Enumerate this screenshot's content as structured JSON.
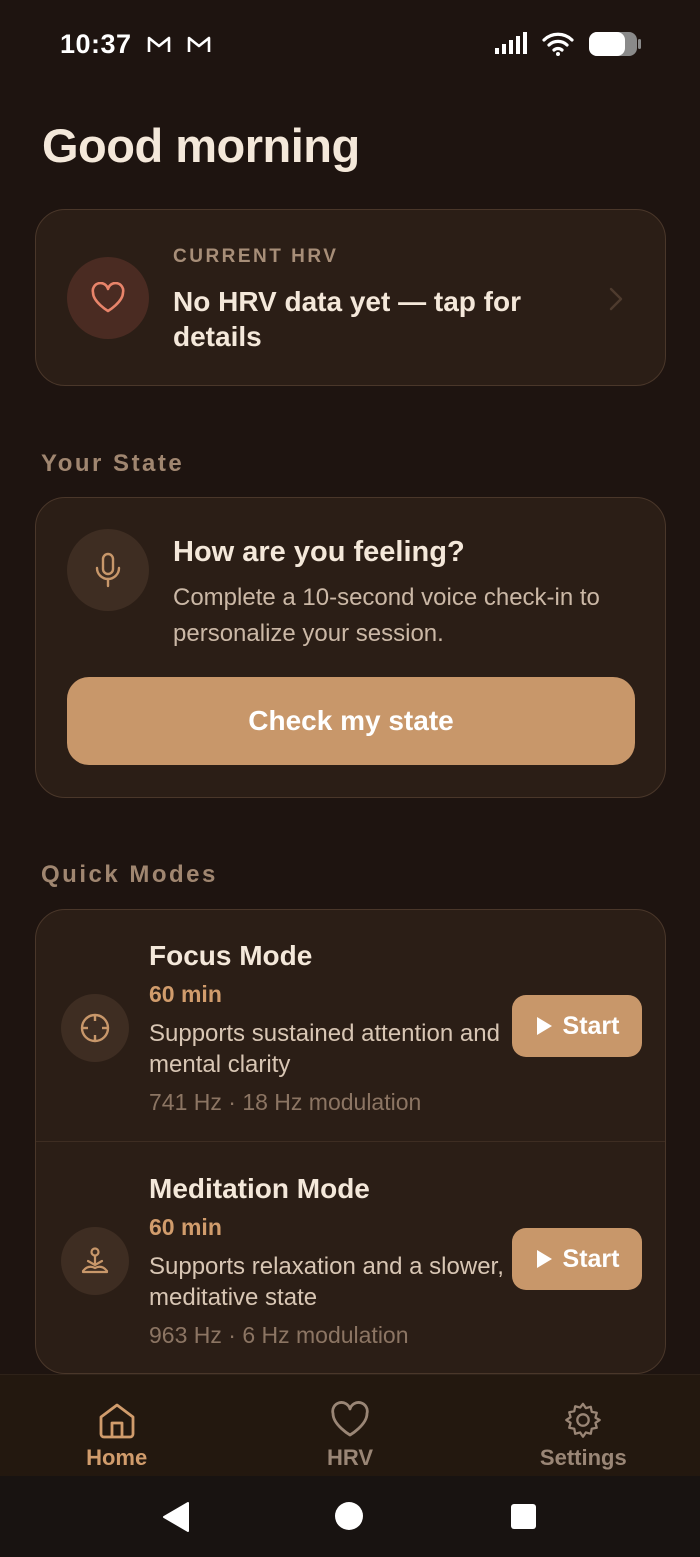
{
  "status_bar": {
    "time": "10:37",
    "notification_icons": [
      "gmail-icon",
      "gmail-icon"
    ],
    "system_icons": [
      "signal-icon",
      "wifi-icon",
      "battery-icon"
    ]
  },
  "greeting": "Good morning",
  "hrv": {
    "label": "CURRENT HRV",
    "value": "No HRV data yet — tap for details",
    "icon": "heart-icon"
  },
  "your_state": {
    "section_title": "Your State",
    "title": "How are you feeling?",
    "description": "Complete a 10-second voice check-in to personalize your session.",
    "icon": "microphone-icon",
    "button_label": "Check my state"
  },
  "quick_modes": {
    "section_title": "Quick Modes",
    "items": [
      {
        "title": "Focus Mode",
        "duration": "60 min",
        "description": "Supports sustained attention and mental clarity",
        "meta": "741 Hz · 18 Hz modulation",
        "icon": "crosshair-icon",
        "button_label": "Start"
      },
      {
        "title": "Meditation Mode",
        "duration": "60 min",
        "description": "Supports relaxation and a slower, meditative state",
        "meta": "963 Hz · 6 Hz modulation",
        "icon": "meditation-icon",
        "button_label": "Start"
      }
    ]
  },
  "tabs": [
    {
      "label": "Home",
      "icon": "home-icon",
      "active": true
    },
    {
      "label": "HRV",
      "icon": "heart-icon",
      "active": false
    },
    {
      "label": "Settings",
      "icon": "gear-icon",
      "active": false
    }
  ],
  "colors": {
    "background": "#1e1410",
    "card": "#2b1e16",
    "accent": "#c8976a",
    "accent_text": "#d19c6c",
    "heart": "#e8846a"
  }
}
